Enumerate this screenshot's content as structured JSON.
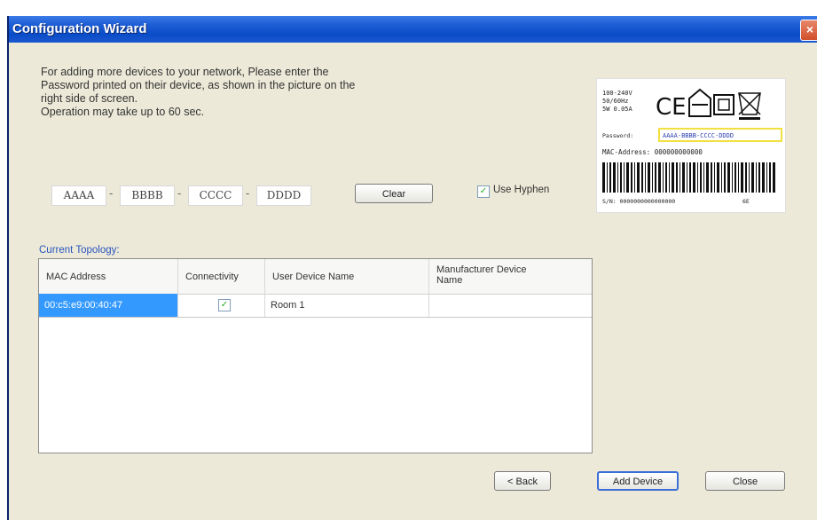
{
  "window": {
    "title": "Configuration Wizard",
    "close_glyph": "×"
  },
  "instructions": [
    "For adding more devices to your network, Please enter the",
    "Password printed on their device, as shown in the picture on the",
    "right side of screen.",
    "Operation may take up to 60 sec."
  ],
  "password": {
    "fields": [
      "AAAA",
      "BBBB",
      "CCCC",
      "DDDD"
    ],
    "separator": "-"
  },
  "buttons": {
    "clear": "Clear",
    "back": "< Back",
    "add_device": "Add Device",
    "close": "Close"
  },
  "use_hyphen": {
    "label": "Use Hyphen",
    "checked": true
  },
  "topology": {
    "label": "Current Topology:",
    "columns": [
      "MAC Address",
      "Connectivity",
      "User Device Name",
      "Manufacturer Device Name"
    ],
    "rows": [
      {
        "mac": "00:c5:e9:00:40:47",
        "connectivity": true,
        "user_name": "Room 1",
        "manufacturer_name": ""
      }
    ]
  },
  "device_label": {
    "specs": [
      "100-240V",
      "50/60Hz",
      "5W 0.05A"
    ],
    "ce": "CE",
    "password_label": "Password:",
    "password_value": "AAAA-BBBB-CCCC-DDDD",
    "mac_line": "MAC-Address: 000000000000",
    "sn_line": "S/N: 0000000000000000",
    "sn_suffix": "6E",
    "highlight_color": "#f0e040"
  }
}
